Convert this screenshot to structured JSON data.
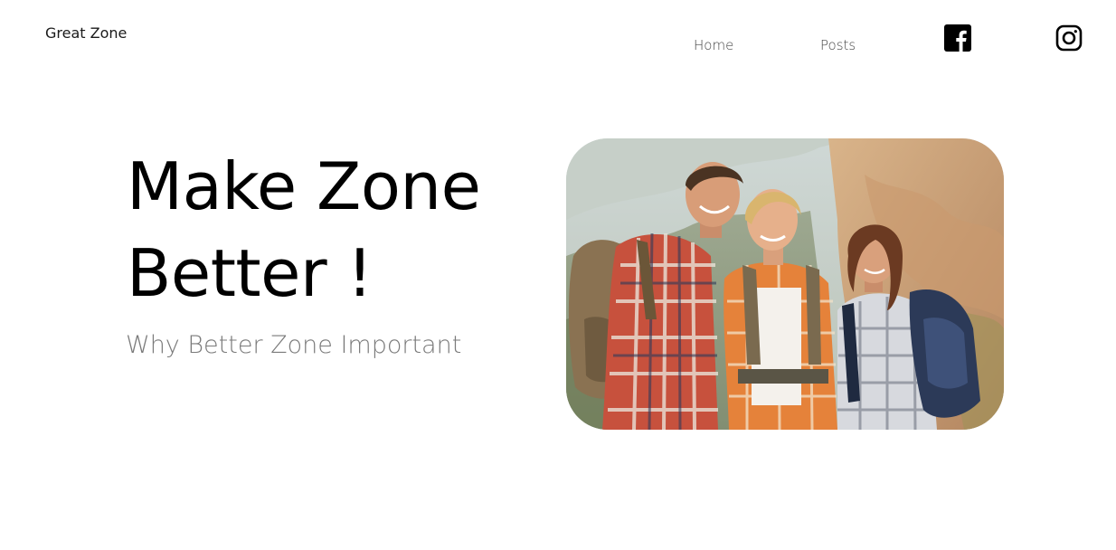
{
  "header": {
    "brand": "Great Zone",
    "nav": {
      "home": "Home",
      "posts": "Posts"
    },
    "social": {
      "facebook_icon": "facebook-icon",
      "instagram_icon": "instagram-icon"
    }
  },
  "hero": {
    "title_line1": "Make Zone",
    "title_line2": "Better !",
    "subtitle": "Why Better Zone Important",
    "image": "hikers-photo"
  },
  "colors": {
    "background": "#ffffff",
    "text": "#000000",
    "subtitle": "#7a7a7a",
    "nav": "#444444"
  }
}
